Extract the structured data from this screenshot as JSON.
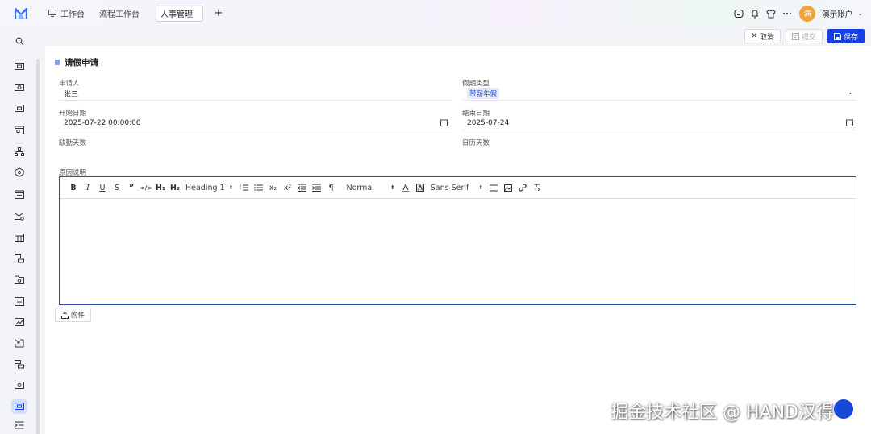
{
  "topbar": {
    "tabs": [
      {
        "label": "工作台"
      },
      {
        "label": "流程工作台"
      },
      {
        "label": "人事管理"
      }
    ],
    "add_tab": "+",
    "account_name": "演示账户",
    "avatar_text": "演"
  },
  "actions": {
    "cancel": "取消",
    "submit": "提交",
    "save": "保存"
  },
  "section": {
    "title": "请假申请"
  },
  "form": {
    "applicant": {
      "label": "申请人",
      "value": "张三"
    },
    "leave_type": {
      "label": "假期类型",
      "value": "带薪年假"
    },
    "start_date": {
      "label": "开始日期",
      "value": "2025-07-22 00:00:00"
    },
    "end_date": {
      "label": "结束日期",
      "value": "2025-07-24"
    },
    "absence_days": {
      "label": "缺勤天数",
      "value": ""
    },
    "calendar_days": {
      "label": "日历天数",
      "value": ""
    },
    "reason": {
      "label": "原因说明"
    }
  },
  "editor": {
    "heading_select": "Heading 1",
    "size_select": "Normal",
    "font_select": "Sans Serif",
    "buttons": {
      "bold": "B",
      "italic": "I",
      "underline": "U",
      "strike": "S",
      "quote": "”",
      "code": "</>",
      "h1": "H₁",
      "h2": "H₂",
      "sub": "x₂",
      "sup": "x²",
      "pilcrow": "¶"
    }
  },
  "attachment": {
    "label": "附件"
  },
  "watermark": {
    "text": "掘金技术社区 @ HAND汉得"
  },
  "colors": {
    "primary": "#1440e6",
    "editor_border": "#2e4f9f",
    "tag_bg": "#e6ecfb",
    "avatar": "#f2a33d"
  }
}
